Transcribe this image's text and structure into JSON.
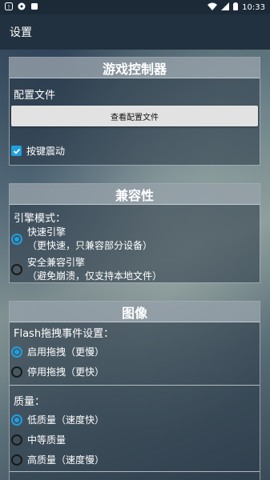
{
  "status_bar": {
    "time": "10:33"
  },
  "app_bar": {
    "title": "设置"
  },
  "game_controller": {
    "header": "游戏控制器",
    "config_label": "配置文件",
    "view_config_button": "查看配置文件",
    "vibration_label": "按键震动",
    "vibration_checked": true
  },
  "compatibility": {
    "header": "兼容性",
    "engine_mode_label": "引擎模式：",
    "options": [
      {
        "line1": "快速引擎",
        "line2": "（更快速，只兼容部分设备）",
        "selected": true
      },
      {
        "line1": "安全兼容引擎",
        "line2": "（避免崩溃，仅支持本地文件）",
        "selected": false
      }
    ]
  },
  "image": {
    "header": "图像",
    "flash_drag_label": "Flash拖拽事件设置：",
    "drag_options": [
      {
        "label": "启用拖拽（更慢）",
        "selected": true
      },
      {
        "label": "停用拖拽（更快）",
        "selected": false
      }
    ],
    "quality_label": "质量：",
    "quality_options": [
      {
        "label": "低质量（速度快）",
        "selected": true
      },
      {
        "label": "中等质量",
        "selected": false
      },
      {
        "label": "高质量（速度慢）",
        "selected": false
      }
    ]
  },
  "colors": {
    "accent": "#1ea0e0",
    "app_bar": "#22313f",
    "status_bar": "#1c2a38"
  }
}
